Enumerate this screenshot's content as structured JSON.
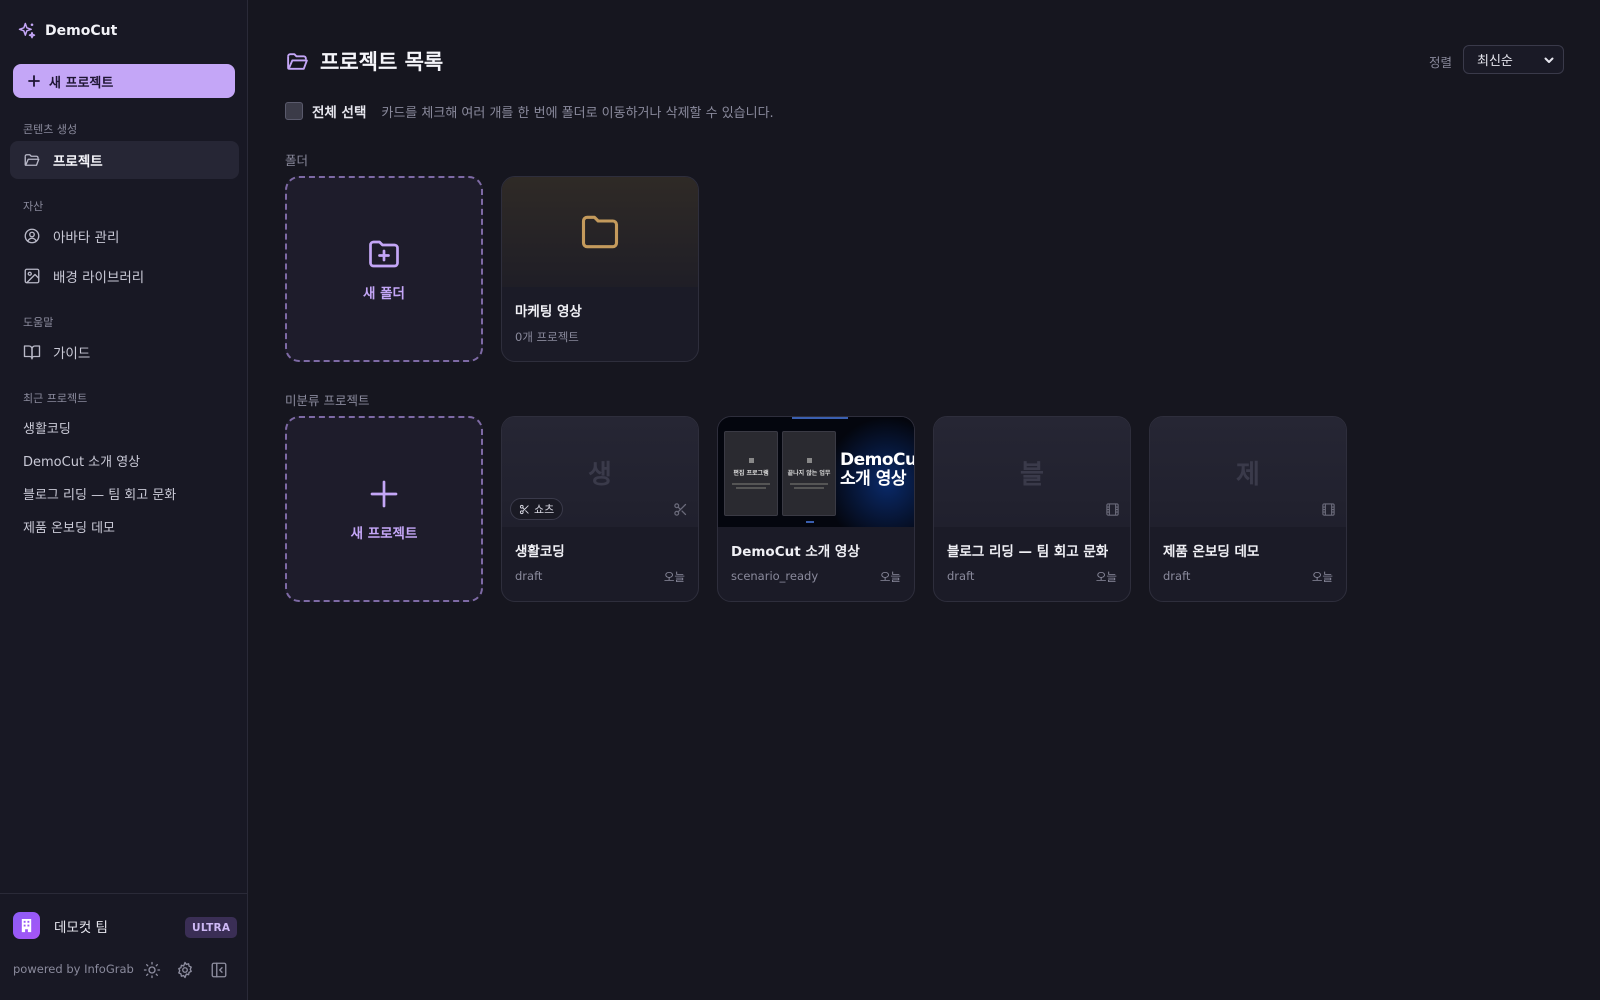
{
  "app": {
    "name": "DemoCut"
  },
  "sidebar": {
    "new_project_label": "새 프로젝트",
    "groups": {
      "create": "콘텐츠 생성",
      "assets": "자산",
      "help": "도움말",
      "recent": "최근 프로젝트"
    },
    "nav": {
      "projects": "프로젝트",
      "avatars": "아바타 관리",
      "backgrounds": "배경 라이브러리",
      "guide": "가이드"
    },
    "recent": [
      "생활코딩",
      "DemoCut 소개 영상",
      "블로그 리딩 — 팀 회고 문화",
      "제품 온보딩 데모"
    ],
    "team": {
      "name": "데모컷 팀",
      "plan": "ULTRA"
    },
    "powered_by": "powered by InfoGrab"
  },
  "main": {
    "title": "프로젝트 목록",
    "sort": {
      "label": "정렬",
      "value": "최신순"
    },
    "select_all": {
      "label": "전체 선택",
      "hint": "카드를 체크해 여러 개를 한 번에 폴더로 이동하거나 삭제할 수 있습니다."
    },
    "folders": {
      "section": "폴더",
      "new_label": "새 폴더",
      "items": [
        {
          "name": "마케팅 영상",
          "count": "0개 프로젝트"
        }
      ]
    },
    "projects": {
      "section": "미분류 프로젝트",
      "new_label": "새 프로젝트",
      "items": [
        {
          "initial": "생",
          "title": "생활코딩",
          "status": "draft",
          "date": "오늘",
          "chip": "쇼츠"
        },
        {
          "title": "DemoCut 소개 영상",
          "status": "scenario_ready",
          "date": "오늘",
          "thumb": {
            "headline_1": "DemoCut",
            "headline_2": "소개 영상",
            "panel_1": "편집 프로그램",
            "panel_2": "끝나지 않는 업무"
          }
        },
        {
          "initial": "블",
          "title": "블로그 리딩 — 팀 회고 문화",
          "status": "draft",
          "date": "오늘"
        },
        {
          "initial": "제",
          "title": "제품 온보딩 데모",
          "status": "draft",
          "date": "오늘"
        }
      ]
    }
  },
  "colors": {
    "accent": "#c4a6f7",
    "folder": "#c49a5c",
    "background": "#16161f"
  }
}
